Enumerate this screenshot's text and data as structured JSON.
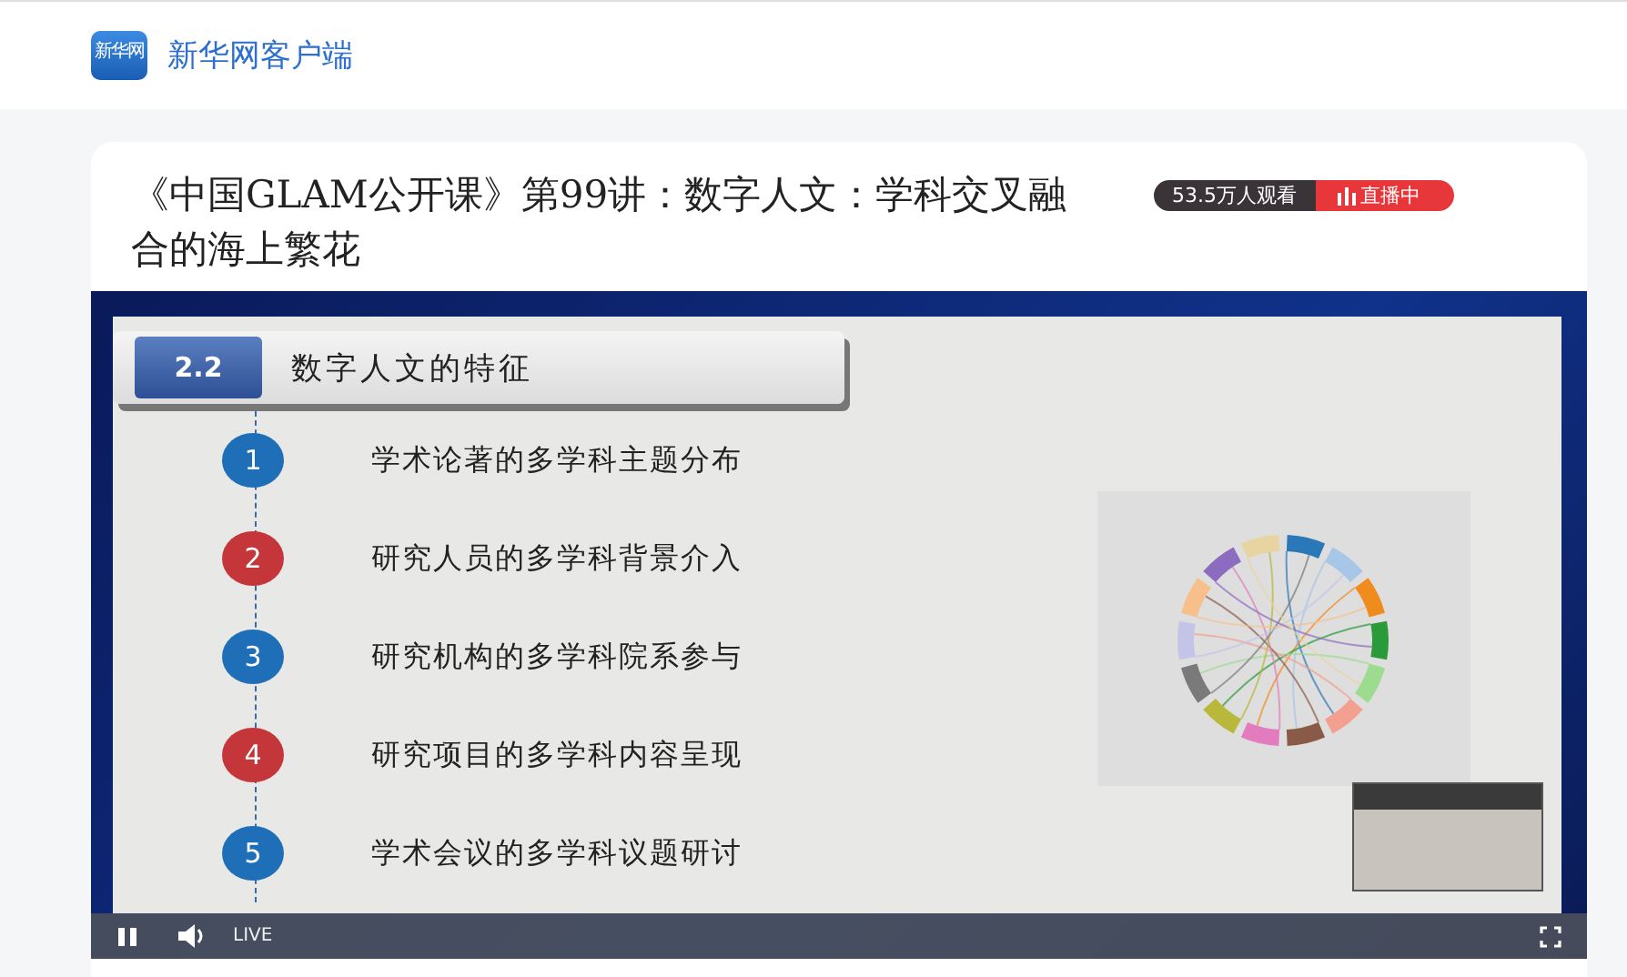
{
  "header": {
    "logo_text": "新华网",
    "app_name": "新华网客户端"
  },
  "article": {
    "title": "《中国GLAM公开课》第99讲：数字人文：学科交叉融合的海上繁花",
    "viewers": "53.5万人观看",
    "live_badge": "直播中"
  },
  "slide": {
    "section_number": "2.2",
    "heading": "数字人文的特征",
    "items": [
      {
        "number": "1",
        "text": "学术论著的多学科主题分布",
        "color": "#1f6fb8"
      },
      {
        "number": "2",
        "text": "研究人员的多学科背景介入",
        "color": "#c4363a"
      },
      {
        "number": "3",
        "text": "研究机构的多学科院系参与",
        "color": "#1f6fb8"
      },
      {
        "number": "4",
        "text": "研究项目的多学科内容呈现",
        "color": "#c4363a"
      },
      {
        "number": "5",
        "text": "学术会议的多学科议题研讨",
        "color": "#1f6fb8"
      }
    ]
  },
  "player": {
    "playing": true,
    "live_label": "LIVE"
  }
}
